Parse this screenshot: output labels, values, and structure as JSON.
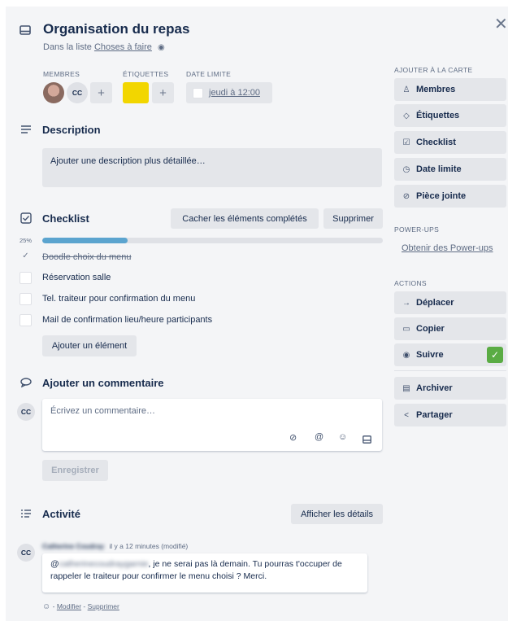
{
  "card": {
    "title": "Organisation du repas",
    "list_prefix": "Dans la liste",
    "list_name": "Choses à faire"
  },
  "labels": {
    "members": "MEMBRES",
    "tags": "ÉTIQUETTES",
    "due": "DATE LIMITE"
  },
  "members": {
    "initials": "CC",
    "add": "+"
  },
  "tags": {
    "color": "#f2d600",
    "add": "+"
  },
  "due": {
    "value": "jeudi à 12:00"
  },
  "description": {
    "title": "Description",
    "placeholder": "Ajouter une description plus détaillée…"
  },
  "checklist": {
    "title": "Checklist",
    "hide_button": "Cacher les éléments complétés",
    "delete_button": "Supprimer",
    "progress_label": "25%",
    "progress_fraction": 0.25,
    "items": [
      {
        "text": "Doodle choix du menu",
        "done": true
      },
      {
        "text": "Réservation salle",
        "done": false
      },
      {
        "text": "Tel. traiteur pour confirmation du menu",
        "done": false
      },
      {
        "text": "Mail de confirmation lieu/heure participants",
        "done": false
      }
    ],
    "add_button": "Ajouter un élément"
  },
  "comment": {
    "title": "Ajouter un commentaire",
    "avatar": "CC",
    "placeholder": "Écrivez un commentaire…",
    "save_button": "Enregistrer"
  },
  "activity": {
    "title": "Activité",
    "details_button": "Afficher les détails",
    "avatar": "CC",
    "author": "Catherine Coudray",
    "meta": "il y a 12 minutes (modifié)",
    "mention": "catherinecoudraygarnie",
    "text": ", je ne serai pas là demain. Tu pourras t'occuper de rappeler le traiteur pour confirmer le menu choisi ? Merci.",
    "edit_link": "Modifier",
    "separator": "-",
    "delete_link": "Supprimer"
  },
  "sidebar": {
    "add_heading": "AJOUTER À LA CARTE",
    "add_items": [
      "Membres",
      "Étiquettes",
      "Checklist",
      "Date limite",
      "Pièce jointe"
    ],
    "powerups_heading": "POWER-UPS",
    "powerups_link": "Obtenir des Power-ups",
    "actions_heading": "ACTIONS",
    "actions": [
      "Déplacer",
      "Copier",
      "Suivre",
      "Archiver",
      "Partager"
    ],
    "follow_color": "#5aac44"
  }
}
